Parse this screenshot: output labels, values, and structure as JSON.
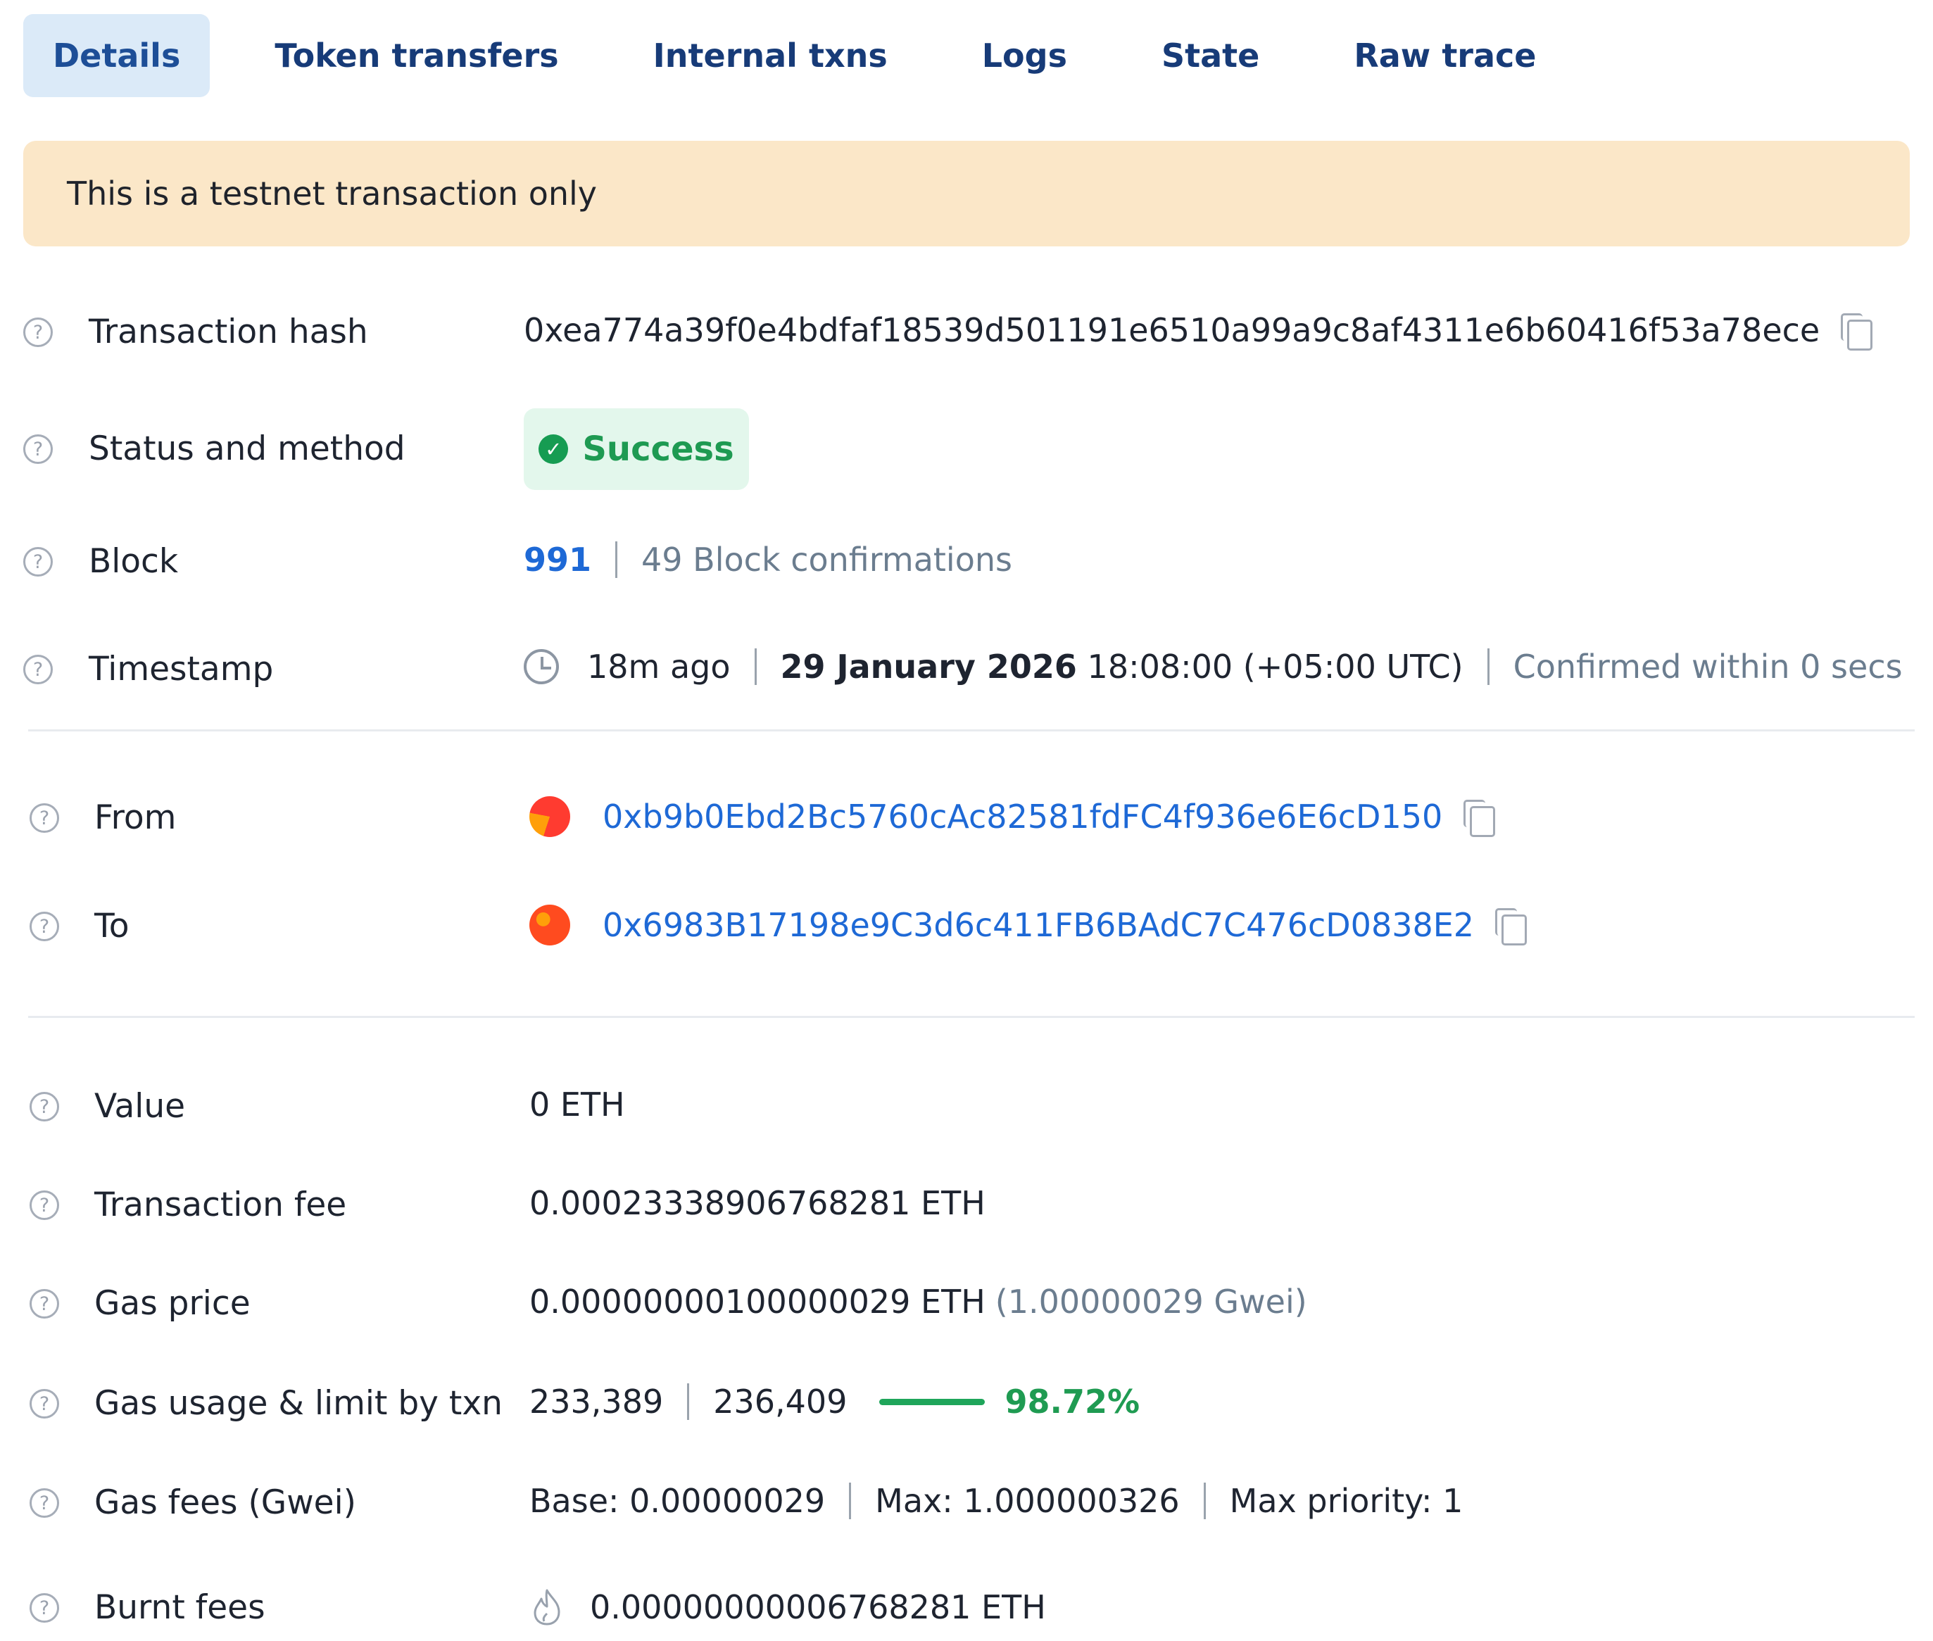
{
  "tabs": [
    {
      "label": "Details"
    },
    {
      "label": "Token transfers"
    },
    {
      "label": "Internal txns"
    },
    {
      "label": "Logs"
    },
    {
      "label": "State"
    },
    {
      "label": "Raw trace"
    }
  ],
  "banner": {
    "text": "This is a testnet transaction only"
  },
  "fields": {
    "tx_hash": {
      "label": "Transaction hash",
      "value": "0xea774a39f0e4bdfaf18539d501191e6510a99a9c8af4311e6b60416f53a78ece"
    },
    "status": {
      "label": "Status and method",
      "value": "Success"
    },
    "block": {
      "label": "Block",
      "number": "991",
      "confirmations": "49 Block confirmations"
    },
    "timestamp": {
      "label": "Timestamp",
      "ago": "18m ago",
      "date": "29 January 2026",
      "time": " 18:08:00 (+05:00 UTC)",
      "confirmed": "Confirmed within 0 secs"
    },
    "from": {
      "label": "From",
      "address": "0xb9b0Ebd2Bc5760cAc82581fdFC4f936e6E6cD150"
    },
    "to": {
      "label": "To",
      "address": "0x6983B17198e9C3d6c411FB6BAdC7C476cD0838E2"
    },
    "value": {
      "label": "Value",
      "value": "0 ETH"
    },
    "fee": {
      "label": "Transaction fee",
      "value": "0.00023338906768281 ETH"
    },
    "gas_price": {
      "label": "Gas price",
      "value": "0.00000000100000029 ETH",
      "gwei": "(1.00000029 Gwei)"
    },
    "gas_usage": {
      "label": "Gas usage & limit by txn",
      "used": "233,389",
      "limit": "236,409",
      "percent": "98.72%",
      "progress": 0.9872
    },
    "gas_fees": {
      "label": "Gas fees (Gwei)",
      "base": "Base: 0.00000029",
      "max": "Max: 1.000000326",
      "priority": "Max priority: 1"
    },
    "burnt": {
      "label": "Burnt fees",
      "value": "0.00000000006768281 ETH"
    }
  },
  "icons": {
    "help": "question-circle-icon",
    "copy": "copy-icon",
    "clock": "clock-icon",
    "flame": "flame-icon",
    "check": "check-circle-icon"
  },
  "colors": {
    "link": "#1e69d6",
    "success": "#1e9a52",
    "banner": "#fbe7c8",
    "active_tab": "#dbeaf8"
  }
}
